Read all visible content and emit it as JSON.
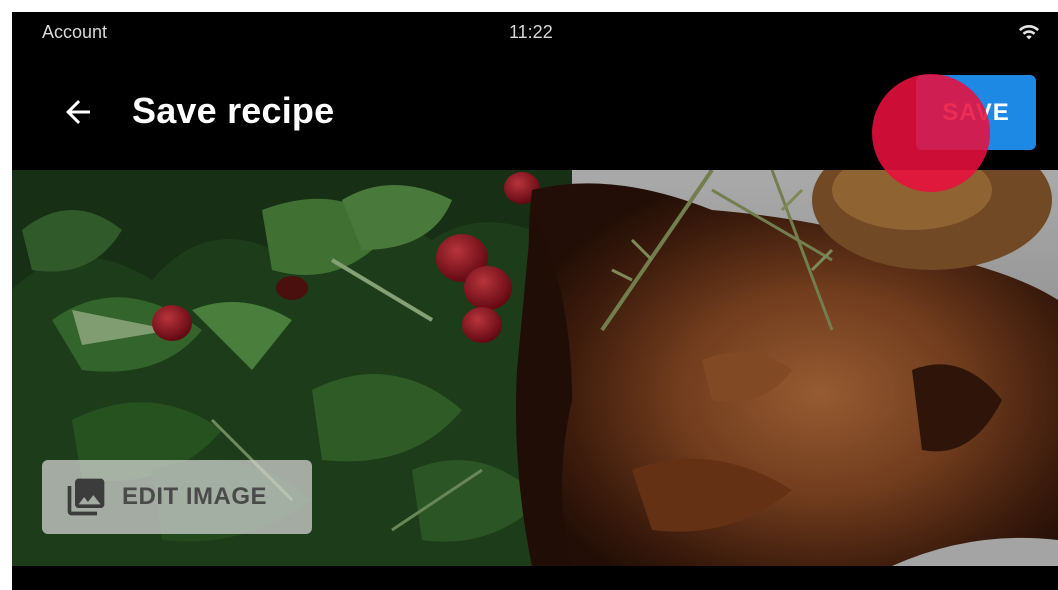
{
  "status_bar": {
    "left_text": "Account",
    "time": "11:22",
    "wifi_icon": "wifi-icon"
  },
  "app_bar": {
    "back_icon": "arrow-back-icon",
    "title": "Save recipe",
    "save_label": "SAVE",
    "save_color": "#1e88e5"
  },
  "recipe_image": {
    "description_icon": "photo-library-icon",
    "edit_label": "EDIT IMAGE"
  },
  "touch_indicator_color": "#e80f3e"
}
